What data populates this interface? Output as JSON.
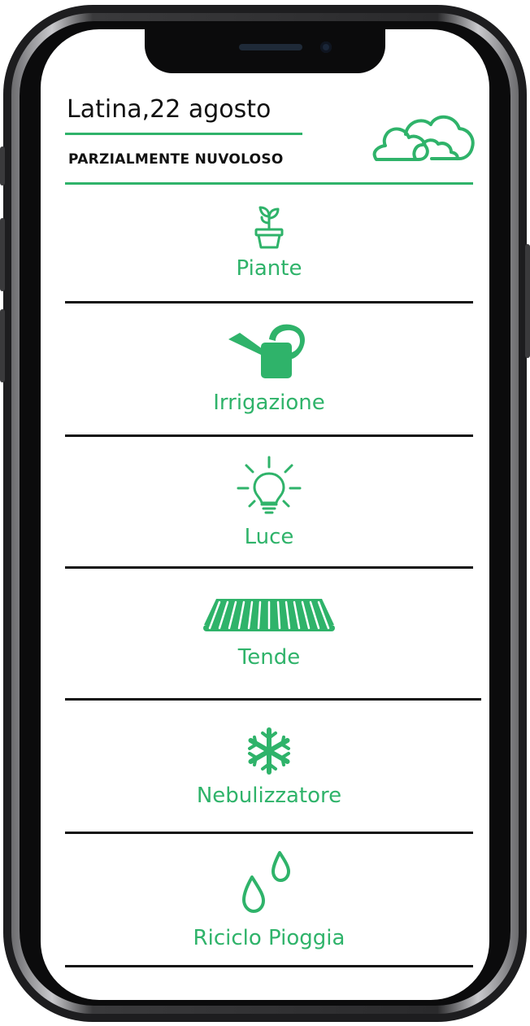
{
  "header": {
    "title": "Latina,22 agosto",
    "condition": "PARZIALMENTE NUVOLOSO",
    "weather_icon": "cloud-icon"
  },
  "colors": {
    "accent": "#2fb36a",
    "text": "#111111",
    "divider": "#111111"
  },
  "menu": [
    {
      "label": "Piante",
      "icon": "plant-pot-icon"
    },
    {
      "label": "Irrigazione",
      "icon": "watering-can-icon"
    },
    {
      "label": "Luce",
      "icon": "light-bulb-icon"
    },
    {
      "label": "Tende",
      "icon": "awning-icon"
    },
    {
      "label": "Nebulizzatore",
      "icon": "snowflake-icon"
    },
    {
      "label": "Riciclo Pioggia",
      "icon": "water-drops-icon"
    }
  ]
}
